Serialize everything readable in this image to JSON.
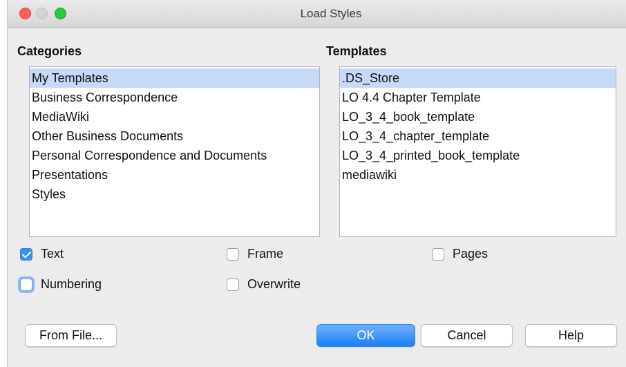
{
  "window": {
    "title": "Load Styles"
  },
  "categories": {
    "heading": "Categories",
    "items": [
      "My Templates",
      "Business Correspondence",
      "MediaWiki",
      "Other Business Documents",
      "Personal Correspondence and Documents",
      "Presentations",
      "Styles"
    ],
    "selected_index": 0
  },
  "templates": {
    "heading": "Templates",
    "items": [
      ".DS_Store",
      "LO 4.4 Chapter Template",
      "LO_3_4_book_template",
      "LO_3_4_chapter_template",
      "LO_3_4_printed_book_template",
      "mediawiki"
    ],
    "selected_index": 0
  },
  "options": {
    "text": {
      "label": "Text",
      "checked": true
    },
    "frame": {
      "label": "Frame",
      "checked": false
    },
    "pages": {
      "label": "Pages",
      "checked": false
    },
    "numbering": {
      "label": "Numbering",
      "checked": false
    },
    "overwrite": {
      "label": "Overwrite",
      "checked": false
    }
  },
  "buttons": {
    "from_file": "From File...",
    "ok": "OK",
    "cancel": "Cancel",
    "help": "Help"
  },
  "colors": {
    "selection": "#c6d9f7",
    "primary_button": "#1b7ef6",
    "checkbox_checked": "#3b8ef3"
  }
}
